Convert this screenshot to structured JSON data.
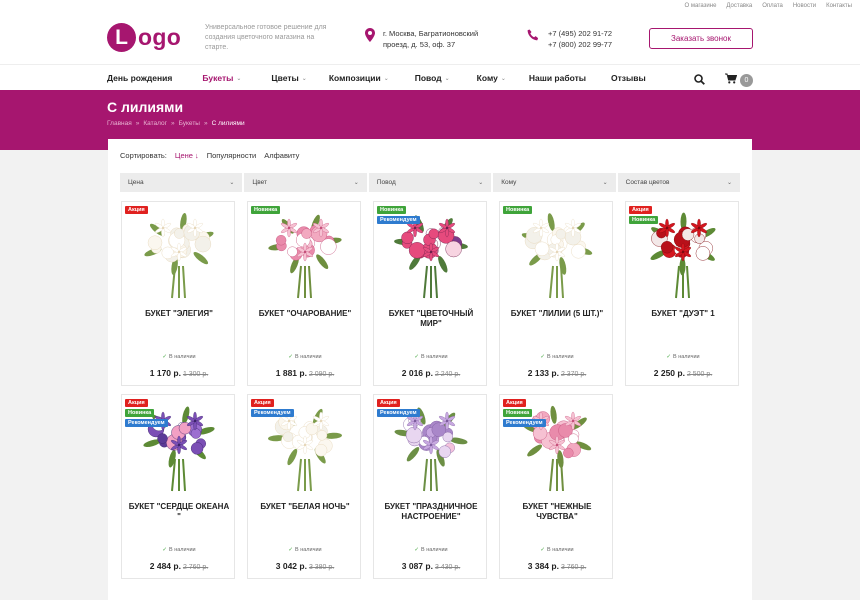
{
  "colors": {
    "brand": "#a6166f",
    "sale": "#e0211f",
    "new": "#3fa43a",
    "recommend": "#2e7bcf"
  },
  "toplinks": [
    "О магазине",
    "Доставка",
    "Оплата",
    "Новости",
    "Контакты"
  ],
  "header": {
    "logo_letter": "L",
    "logo_rest": "ogo",
    "tagline": "Универсальное готовое решение для создания цветочного магазина на старте.",
    "address": "г. Москва, Багратионовский проезд, д. 53, оф. 37",
    "phone1": "+7 (495) 202 91-72",
    "phone2": "+7 (800) 202 99-77",
    "call_button": "Заказать звонок"
  },
  "nav": {
    "items": [
      {
        "label": "День рождения",
        "caret": false
      },
      {
        "label": "Букеты",
        "caret": true,
        "active": true
      },
      {
        "label": "Цветы",
        "caret": true
      },
      {
        "label": "Композиции",
        "caret": true
      },
      {
        "label": "Повод",
        "caret": true
      },
      {
        "label": "Кому",
        "caret": true
      },
      {
        "label": "Наши работы",
        "caret": false
      },
      {
        "label": "Отзывы",
        "caret": false
      }
    ],
    "cart_count": "0"
  },
  "banner": {
    "title": "С лилиями",
    "breadcrumbs": [
      "Главная",
      "Каталог",
      "Букеты",
      "С лилиями"
    ]
  },
  "sort": {
    "label": "Сортировать:",
    "options": [
      "Цене",
      "Популярности",
      "Алфавиту"
    ],
    "active_suffix": "↓"
  },
  "filters": [
    "Цена",
    "Цвет",
    "Повод",
    "Кому",
    "Состав цветов"
  ],
  "labels": {
    "sale": "Акция",
    "new": "Новинка",
    "recommend": "Рекомендуем",
    "in_stock": "В наличии"
  },
  "products": [
    {
      "name": "Букет \"Элегия\"",
      "badges": [
        "sale"
      ],
      "price": "1 170 р.",
      "old": "1 300 р.",
      "palette": "white"
    },
    {
      "name": "Букет \"Очарование\"",
      "badges": [
        "new"
      ],
      "price": "1 881 р.",
      "old": "2 090 р.",
      "palette": "pink"
    },
    {
      "name": "Букет \"Цветочный мир\"",
      "badges": [
        "new",
        "recommend"
      ],
      "price": "2 016 р.",
      "old": "2 240 р.",
      "palette": "mix"
    },
    {
      "name": "Букет \"Лилии (5 шт.)\"",
      "badges": [
        "new"
      ],
      "price": "2 133 р.",
      "old": "2 370 р.",
      "palette": "white"
    },
    {
      "name": "Букет \"Дуэт\" 1",
      "badges": [
        "sale",
        "new"
      ],
      "price": "2 250 р.",
      "old": "2 500 р.",
      "palette": "red"
    },
    {
      "name": "Букет \"Сердце океана \"",
      "badges": [
        "sale",
        "new",
        "recommend"
      ],
      "price": "2 484 р.",
      "old": "2 760 р.",
      "palette": "purple"
    },
    {
      "name": "Букет \"Белая ночь\"",
      "badges": [
        "sale",
        "recommend"
      ],
      "price": "3 042 р.",
      "old": "3 380 р.",
      "palette": "white"
    },
    {
      "name": "Букет \"Праздничное настроение\"",
      "badges": [
        "sale",
        "recommend"
      ],
      "price": "3 087 р.",
      "old": "3 430 р.",
      "palette": "lilac"
    },
    {
      "name": "Букет \"Нежные чувства\"",
      "badges": [
        "sale",
        "new",
        "recommend"
      ],
      "price": "3 384 р.",
      "old": "3 760 р.",
      "palette": "pink"
    }
  ]
}
